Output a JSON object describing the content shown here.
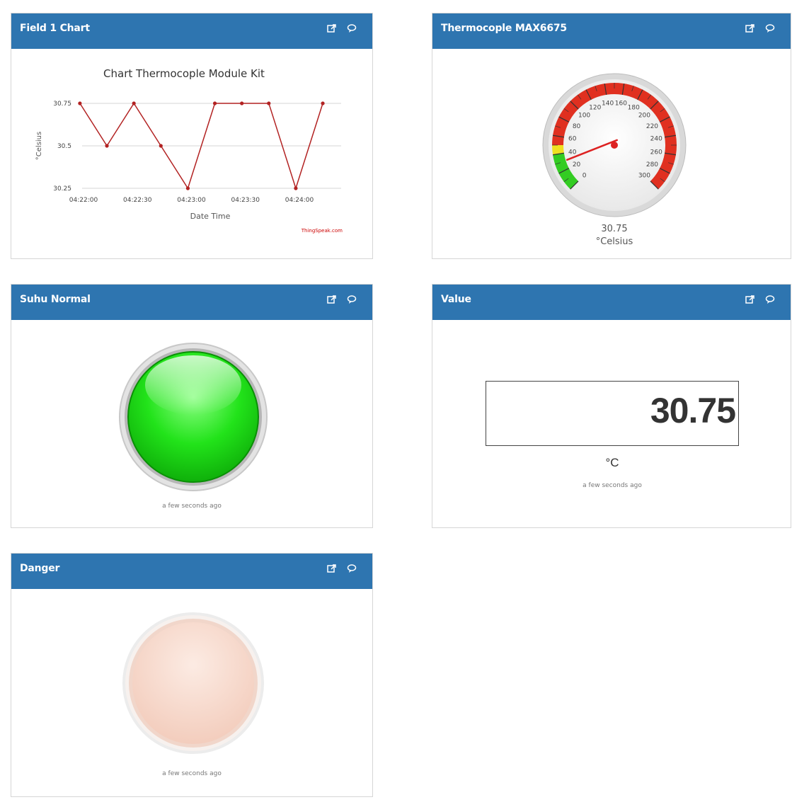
{
  "widgets": {
    "chart": {
      "title": "Field 1 Chart",
      "chart_title": "Chart Thermocople Module Kit",
      "credit": "ThingSpeak.com"
    },
    "gauge": {
      "title": "Thermocople MAX6675",
      "ticks": [
        "0",
        "20",
        "40",
        "60",
        "80",
        "100",
        "120",
        "140",
        "160",
        "180",
        "200",
        "220",
        "240",
        "260",
        "280",
        "300"
      ],
      "value": "30.75",
      "unit": "°Celsius"
    },
    "normal": {
      "title": "Suhu Normal",
      "caption": "a few seconds ago",
      "lamp_color": "#22e31a",
      "state": "on"
    },
    "value": {
      "title": "Value",
      "value": "30.75",
      "unit": "°C",
      "caption": "a few seconds ago"
    },
    "danger": {
      "title": "Danger",
      "caption": "a few seconds ago",
      "lamp_color": "#f6d3c4",
      "state": "off"
    }
  },
  "icons": {
    "popout": "external-link-icon",
    "comment": "comment-icon"
  },
  "colors": {
    "header": "#2e75b0",
    "line": "#b22222",
    "gauge_red": "#e03020",
    "gauge_green": "#33cc22",
    "gauge_yellow": "#f0e020"
  },
  "chart_data": {
    "type": "line",
    "title": "Chart Thermocople Module Kit",
    "xlabel": "Date Time",
    "ylabel": "°Celsius",
    "x_ticks": [
      "04:22:00",
      "04:22:30",
      "04:23:00",
      "04:23:30",
      "04:24:00"
    ],
    "y_ticks": [
      "30.25",
      "30.5",
      "30.75"
    ],
    "ylim": [
      30.25,
      30.75
    ],
    "grid": true,
    "series": [
      {
        "x": [
          "04:21:58",
          "04:22:13",
          "04:22:28",
          "04:22:43",
          "04:22:58",
          "04:23:13",
          "04:23:28",
          "04:23:43",
          "04:23:58",
          "04:24:13"
        ],
        "values": [
          30.75,
          30.5,
          30.75,
          30.5,
          30.25,
          30.75,
          30.75,
          30.75,
          30.25,
          30.75
        ]
      }
    ]
  }
}
